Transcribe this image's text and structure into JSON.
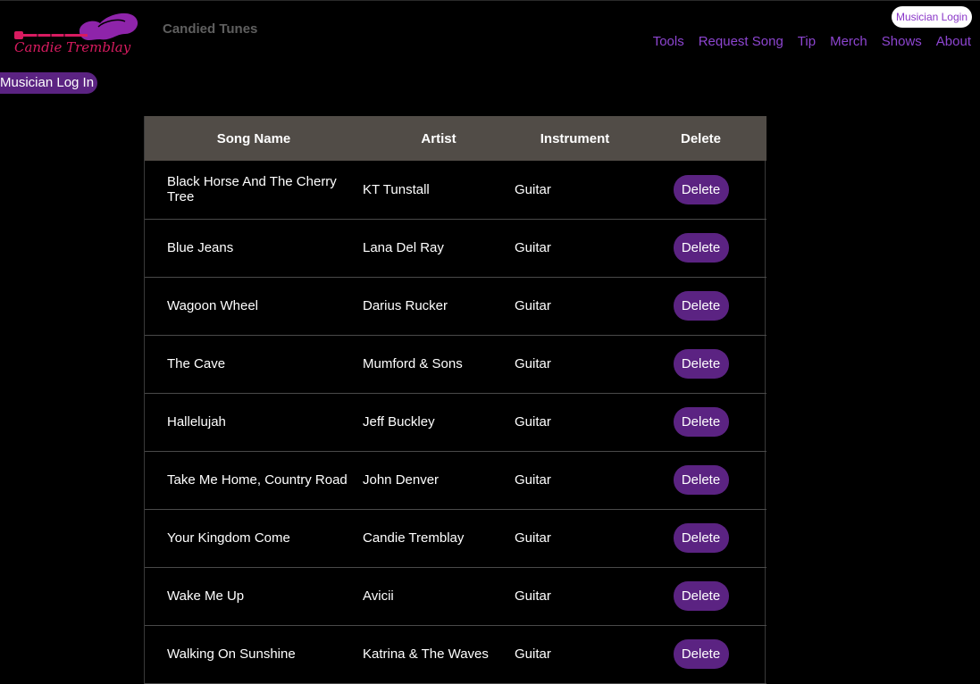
{
  "header": {
    "logo_text": "Candie Tremblay",
    "brand": "Candied Tunes",
    "login_pill": "Musician Login",
    "nav": [
      "Tools",
      "Request Song",
      "Tip",
      "Merch",
      "Shows",
      "About"
    ]
  },
  "side_login": "Musician Log In",
  "table": {
    "headers": [
      "Song Name",
      "Artist",
      "Instrument",
      "Delete"
    ],
    "delete_label": "Delete",
    "rows": [
      {
        "song": "Black Horse And The Cherry Tree",
        "artist": "KT Tunstall",
        "instrument": "Guitar"
      },
      {
        "song": "Blue Jeans",
        "artist": "Lana Del Ray",
        "instrument": "Guitar"
      },
      {
        "song": "Wagoon Wheel",
        "artist": "Darius Rucker",
        "instrument": "Guitar"
      },
      {
        "song": "The Cave",
        "artist": "Mumford & Sons",
        "instrument": "Guitar"
      },
      {
        "song": "Hallelujah",
        "artist": "Jeff Buckley",
        "instrument": "Guitar"
      },
      {
        "song": "Take Me Home, Country Road",
        "artist": "John Denver",
        "instrument": "Guitar"
      },
      {
        "song": "Your Kingdom Come",
        "artist": "Candie Tremblay",
        "instrument": "Guitar"
      },
      {
        "song": "Wake Me Up",
        "artist": "Avicii",
        "instrument": "Guitar"
      },
      {
        "song": "Walking On Sunshine",
        "artist": "Katrina & The Waves",
        "instrument": "Guitar"
      }
    ]
  },
  "colors": {
    "accent": "#8d45d0",
    "button": "#5b2382",
    "header_row": "#514c47",
    "logo_pink": "#d81b60",
    "logo_purple": "#8e24aa"
  }
}
